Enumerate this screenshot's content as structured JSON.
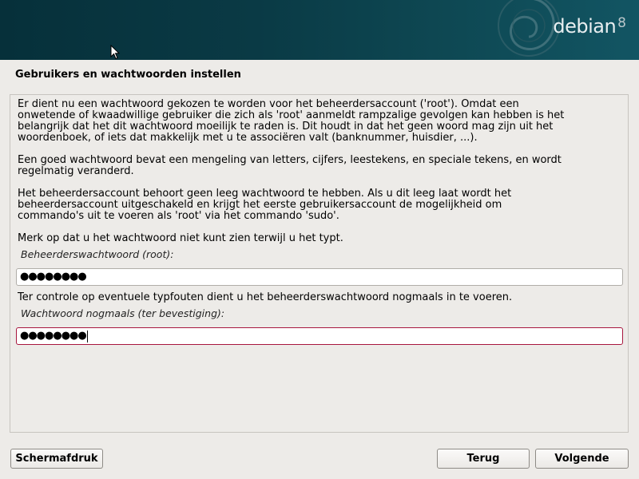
{
  "header": {
    "logo_text": "debian",
    "logo_version": "8"
  },
  "page": {
    "title": "Gebruikers en wachtwoorden instellen"
  },
  "body": {
    "para1": "Er dient nu een wachtwoord gekozen te worden voor het beheerdersaccount ('root'). Omdat een\nonwetende of kwaadwillige gebruiker die zich als 'root' aanmeldt rampzalige gevolgen kan hebben is het\nbelangrijk dat het dit wachtwoord moeilijk te raden is. Dit houdt in dat het geen woord mag zijn uit het\nwoordenboek, of iets dat makkelijk met u te associëren valt (banknummer, huisdier, ...).",
    "para2": "Een goed wachtwoord bevat een mengeling van letters, cijfers, leestekens, en speciale tekens, en wordt\nregelmatig veranderd.",
    "para3": "Het beheerdersaccount behoort geen leeg wachtwoord te hebben. Als u dit leeg laat wordt het\nbeheerdersaccount uitgeschakeld en krijgt het eerste gebruikersaccount de mogelijkheid om\ncommando's uit te voeren als 'root' via het commando 'sudo'.",
    "para4": "Merk op dat u het wachtwoord niet kunt zien terwijl u het typt.",
    "root_password_label": "Beheerderswachtwoord (root):",
    "root_password_value": "●●●●●●●●",
    "confirm_instruction": "Ter controle op eventuele typfouten dient u het beheerderswachtwoord nogmaals in te voeren.",
    "confirm_password_label": "Wachtwoord nogmaals (ter bevestiging):",
    "confirm_password_value": "●●●●●●●●"
  },
  "buttons": {
    "screenshot": "Schermafdruk",
    "back": "Terug",
    "continue": "Volgende"
  },
  "colors": {
    "banner": "#0a3a45",
    "background": "#edebe8",
    "focus_border": "#a8163e"
  }
}
